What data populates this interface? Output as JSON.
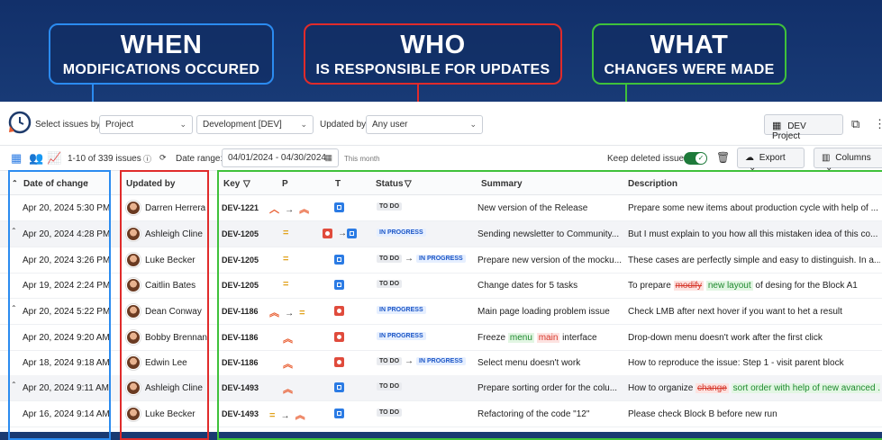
{
  "callouts": {
    "when": {
      "big": "WHEN",
      "small": "MODIFICATIONS OCCURED"
    },
    "who": {
      "big": "WHO",
      "small": "IS RESPONSIBLE FOR UPDATES"
    },
    "what": {
      "big": "WHAT",
      "small": "CHANGES WERE MADE"
    }
  },
  "filters": {
    "select_label": "Select issues by:",
    "select_value": "Project",
    "project_value": "Development [DEV]",
    "updated_by_label": "Updated by:",
    "updated_by_value": "Any user",
    "dev_project_button": "DEV Project"
  },
  "toolbar": {
    "count": "1-10 of 339 issues",
    "date_range_label": "Date range:",
    "date_range_value": "04/01/2024 - 04/30/2024",
    "this_month": "This month",
    "keep_deleted": "Keep deleted issues",
    "export": "Export",
    "columns": "Columns"
  },
  "headers": {
    "date": "Date of change",
    "updated_by": "Updated by",
    "key": "Key",
    "p": "P",
    "t": "T",
    "status": "Status",
    "summary": "Summary",
    "description": "Description"
  },
  "rows": [
    {
      "date": "Apr 20, 2024 5:30 PM",
      "user": "Darren Herrera",
      "key": "DEV-1221",
      "status_from": "TO DO",
      "summary": "New version of the Release",
      "description": "Prepare some new items about production cycle with help of ..."
    },
    {
      "date": "Apr 20, 2024 4:28 PM",
      "user": "Ashleigh Cline",
      "key": "DEV-1205",
      "status_from": "IN PROGRESS",
      "summary": "Sending newsletter to Community...",
      "description": "But I must explain to you how all this mistaken idea of this co..."
    },
    {
      "date": "Apr 20, 2024 3:26 PM",
      "user": "Luke Becker",
      "key": "DEV-1205",
      "status_from": "TO DO",
      "status_to": "IN PROGRESS",
      "summary": "Prepare new version of the mocku...",
      "description": "These cases are perfectly simple and easy to distinguish. In a..."
    },
    {
      "date": "Apr 19, 2024 2:24 PM",
      "user": "Caitlin Bates",
      "key": "DEV-1205",
      "status_from": "TO DO",
      "summary": "Change dates for 5 tasks",
      "desc_a": "To prepare",
      "desc_del": "modify",
      "desc_ins": "new layout",
      "desc_b": "of desing for the Block A1"
    },
    {
      "date": "Apr 20, 2024 5:22 PM",
      "user": "Dean Conway",
      "key": "DEV-1186",
      "status_from": "IN PROGRESS",
      "summary": "Main page loading problem issue",
      "description": "Check LMB after next hover if you want to het a result"
    },
    {
      "date": "Apr 20, 2024 9:20 AM",
      "user": "Bobby Brennan",
      "key": "DEV-1186",
      "status_from": "IN PROGRESS",
      "sum_a": "Freeze",
      "sum_ins": "menu",
      "sum_del": "main",
      "sum_b": "interface",
      "description": "Drop-down menu doesn't work after the first click"
    },
    {
      "date": "Apr 18, 2024 9:18 AM",
      "user": "Edwin Lee",
      "key": "DEV-1186",
      "status_from": "TO DO",
      "status_to": "IN PROGRESS",
      "summary": "Select menu doesn't work",
      "description": "How to reproduce the issue: Step 1 - visit parent block"
    },
    {
      "date": "Apr 20, 2024 9:11 AM",
      "user": "Ashleigh Cline",
      "key": "DEV-1493",
      "status_from": "TO DO",
      "summary": "Prepare sorting order for the colu...",
      "desc_a": "How to organize",
      "desc_del": "change",
      "desc_ins": "sort order with help of new avanced ..."
    },
    {
      "date": "Apr 16, 2024 9:14 AM",
      "user": "Luke Becker",
      "key": "DEV-1493",
      "status_from": "TO DO",
      "summary": "Refactoring of the code \"12\"",
      "description": "Please check Block B before new run"
    }
  ]
}
